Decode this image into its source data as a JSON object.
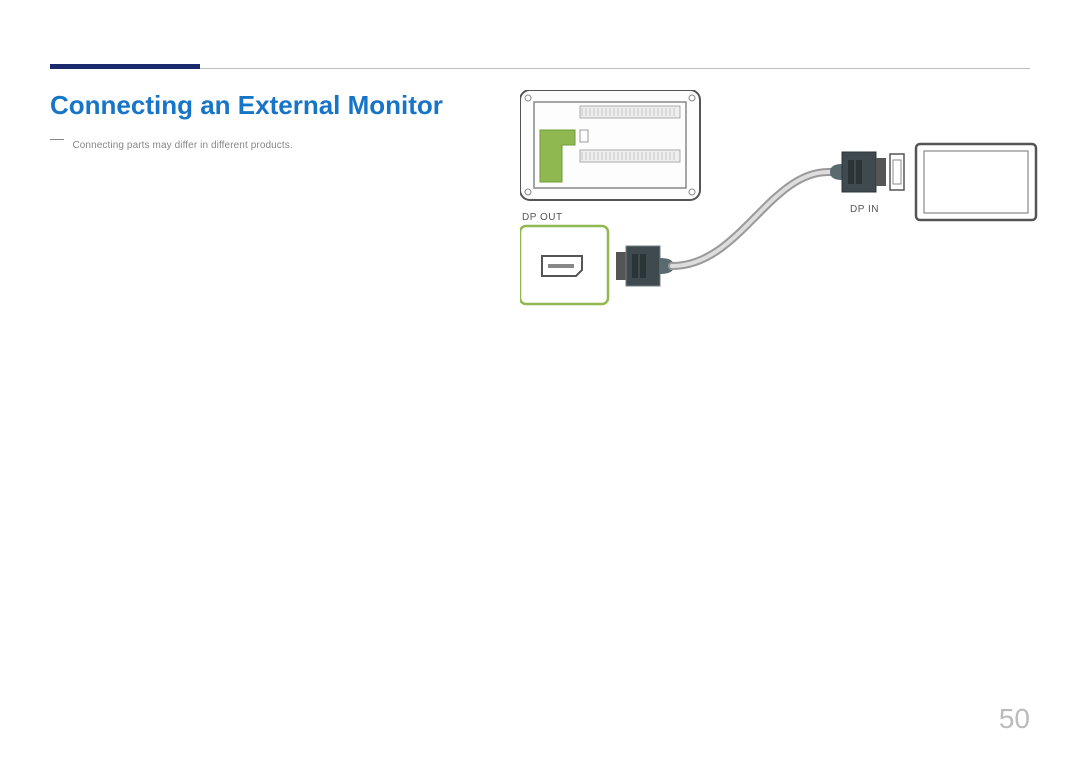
{
  "title": "Connecting an External Monitor",
  "note": "Connecting parts may differ in different products.",
  "labels": {
    "dp_out": "DP OUT",
    "dp_in": "DP IN"
  },
  "page_number": "50"
}
